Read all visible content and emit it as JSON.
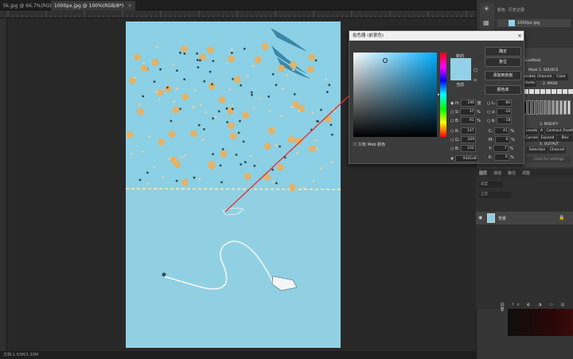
{
  "tabs": [
    {
      "label": "5k.jpg @ 66.7%(RGB/8*)",
      "active": false
    },
    {
      "label": "1000px.jpg @ 100%(RGB/8*)",
      "active": true
    }
  ],
  "status": {
    "text": "文档:1.93M/1.93M"
  },
  "history_panel": {
    "tab_label": "颜色",
    "tab2_label": "历史记录",
    "item": "1000px.jpg"
  },
  "color_panel": {
    "head1": "Mask 1. SOURCE",
    "b1": "Visible",
    "b2": "Channel",
    "b3": "Color",
    "head2": "2. MASK",
    "b4": "Darks",
    "head3": "3. MODIFY",
    "b5": "Levels",
    "b6": "A",
    "b7": "Contract",
    "b8": "Feather",
    "b9": "Curves",
    "b10": "Expand",
    "b11": "Blur",
    "head4": "4. OUTPUT",
    "b12": "Selection",
    "b13": "Channel",
    "b14": "Click for settings",
    "lm": "LuxMask"
  },
  "layers_panel": {
    "tabs": [
      "图层",
      "通道",
      "路径",
      "调整"
    ],
    "kind_label": "类型",
    "mode_label": "正常",
    "layer_name": "背景"
  },
  "color_picker": {
    "title": "拾色器 (前景色)",
    "new_label": "新的",
    "current_label": "当前",
    "ok_label": "确定",
    "cancel_label": "复位",
    "add_swatch_label": "添加到色板",
    "libraries_label": "颜色库",
    "web_only_label": "只有 Web 颜色",
    "fields": {
      "H": "196",
      "S": "37",
      "B": "91",
      "R": "147",
      "G": "209",
      "Bv": "232",
      "L": "80",
      "a": "-16",
      "b": "-18",
      "C": "41",
      "M": "6",
      "Y": "7",
      "K": "0"
    },
    "units": {
      "H": "度",
      "pct": "%"
    },
    "hex": "93d1e8"
  },
  "colors": {
    "new": "#93d1e8",
    "current": "#93d1e8",
    "arrow": "#e33"
  }
}
